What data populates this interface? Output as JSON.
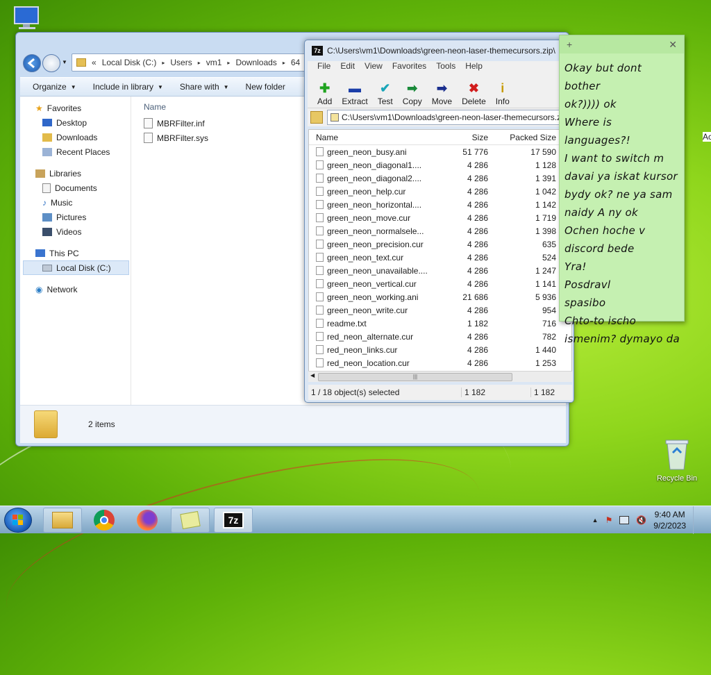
{
  "desktop": {
    "recycle_bin_label": "Recycle Bin"
  },
  "explorer": {
    "breadcrumb": [
      "«",
      "Local Disk (C:)",
      "Users",
      "vm1",
      "Downloads",
      "64"
    ],
    "commands": [
      "Organize",
      "Include in library",
      "Share with",
      "New folder"
    ],
    "nav": {
      "favorites": "Favorites",
      "desktop": "Desktop",
      "downloads": "Downloads",
      "recent_places": "Recent Places",
      "libraries": "Libraries",
      "documents": "Documents",
      "music": "Music",
      "pictures": "Pictures",
      "videos": "Videos",
      "this_pc": "This PC",
      "local_disk": "Local Disk (C:)",
      "network": "Network"
    },
    "column_name": "Name",
    "files": [
      "MBRFilter.inf",
      "MBRFilter.sys"
    ],
    "status_count": "2 items"
  },
  "zip": {
    "title": "C:\\Users\\vm1\\Downloads\\green-neon-laser-themecursors.zip\\",
    "menu": [
      "File",
      "Edit",
      "View",
      "Favorites",
      "Tools",
      "Help"
    ],
    "toolbar": [
      {
        "label": "Add",
        "icon": "add-icon",
        "color": "#1fa31f"
      },
      {
        "label": "Extract",
        "icon": "extract-icon",
        "color": "#1b3ea8"
      },
      {
        "label": "Test",
        "icon": "test-icon",
        "color": "#19a5b8"
      },
      {
        "label": "Copy",
        "icon": "copy-icon",
        "color": "#1a8a3a"
      },
      {
        "label": "Move",
        "icon": "move-icon",
        "color": "#1b2f8e"
      },
      {
        "label": "Delete",
        "icon": "delete-icon",
        "color": "#d11c1c"
      },
      {
        "label": "Info",
        "icon": "info-icon",
        "color": "#c79b00"
      }
    ],
    "path": "C:\\Users\\vm1\\Downloads\\green-neon-laser-themecursors.zip\\",
    "columns": {
      "name": "Name",
      "size": "Size",
      "packed": "Packed Size",
      "extra": "Ac"
    },
    "rows": [
      {
        "name": "green_neon_busy.ani",
        "size": "51 776",
        "packed": "17 590"
      },
      {
        "name": "green_neon_diagonal1....",
        "size": "4 286",
        "packed": "1 128"
      },
      {
        "name": "green_neon_diagonal2....",
        "size": "4 286",
        "packed": "1 391"
      },
      {
        "name": "green_neon_help.cur",
        "size": "4 286",
        "packed": "1 042"
      },
      {
        "name": "green_neon_horizontal....",
        "size": "4 286",
        "packed": "1 142"
      },
      {
        "name": "green_neon_move.cur",
        "size": "4 286",
        "packed": "1 719"
      },
      {
        "name": "green_neon_normalsele...",
        "size": "4 286",
        "packed": "1 398"
      },
      {
        "name": "green_neon_precision.cur",
        "size": "4 286",
        "packed": "635"
      },
      {
        "name": "green_neon_text.cur",
        "size": "4 286",
        "packed": "524"
      },
      {
        "name": "green_neon_unavailable....",
        "size": "4 286",
        "packed": "1 247"
      },
      {
        "name": "green_neon_vertical.cur",
        "size": "4 286",
        "packed": "1 141"
      },
      {
        "name": "green_neon_working.ani",
        "size": "21 686",
        "packed": "5 936"
      },
      {
        "name": "green_neon_write.cur",
        "size": "4 286",
        "packed": "954"
      },
      {
        "name": "readme.txt",
        "size": "1 182",
        "packed": "716"
      },
      {
        "name": "red_neon_alternate.cur",
        "size": "4 286",
        "packed": "782"
      },
      {
        "name": "red_neon_links.cur",
        "size": "4 286",
        "packed": "1 440"
      },
      {
        "name": "red_neon_location.cur",
        "size": "4 286",
        "packed": "1 253"
      }
    ],
    "status": {
      "selected": "1 / 18 object(s) selected",
      "size": "1 182",
      "packed": "1 182"
    }
  },
  "note": {
    "lines": [
      "Okay but dont bother",
      "ok?)))) ok",
      "Where is languages?!",
      "I want to switch m",
      "davai ya iskat kursor",
      "bydy ok? ne ya sam",
      "naidy A ny ok",
      "Ochen hoche v",
      "discord bede",
      "Yra!",
      "Posdravl",
      "spasibo",
      "Chto-to ischo",
      "ismenim? dymayo da"
    ]
  },
  "taskbar": {
    "time": "9:40 AM",
    "date": "9/2/2023",
    "apps": [
      "explorer-icon",
      "chrome-icon",
      "firefox-icon",
      "sticky-notes-icon",
      "7zip-icon"
    ]
  }
}
